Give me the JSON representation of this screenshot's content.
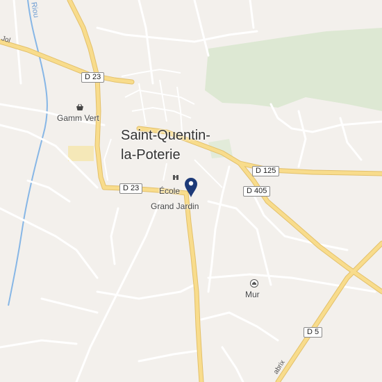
{
  "map": {
    "town_name_line1": "Saint-Quentin-",
    "town_name_line2": "la-Poterie",
    "road_shields": {
      "d23_north": "D 23",
      "d23_south": "D 23",
      "d125": "D 125",
      "d405": "D 405",
      "d5": "D 5"
    },
    "pois": {
      "gamm_vert": "Gamm Vert",
      "ecole": "École",
      "grand_jardin": "Grand Jardin",
      "mur": "Mur"
    },
    "river_name": "Riou",
    "road_fragment_west": "Jol",
    "road_fragment_southeast": "abrix",
    "colors": {
      "background": "#f3f0ec",
      "main_road": "#f6d98a",
      "main_road_edge": "#e3c06a",
      "minor_road": "#ffffff",
      "forest": "#d9e6cf",
      "water": "#7fb0e0",
      "pin": "#1d3a78"
    },
    "icons": [
      "shopping-basket-icon",
      "school-icon",
      "location-pin-icon",
      "monument-icon"
    ]
  }
}
